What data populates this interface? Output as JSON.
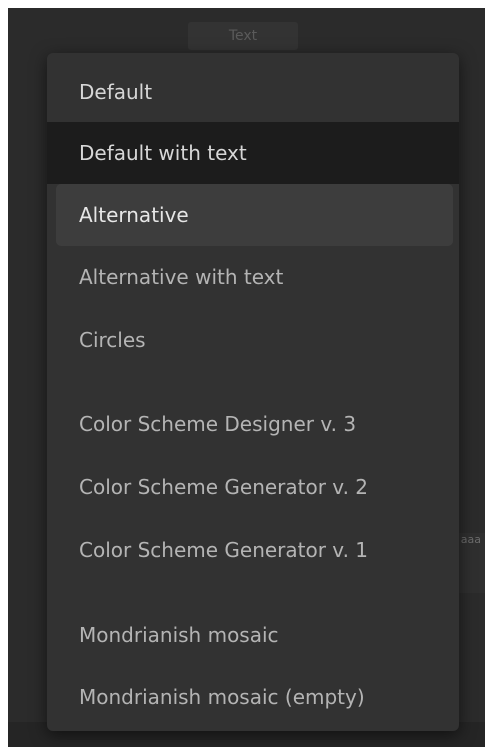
{
  "background": {
    "top_hint": "Text",
    "side_hint": "aa\naaa"
  },
  "menu": {
    "items": [
      {
        "label": "Default",
        "state": "normal"
      },
      {
        "label": "Default with text",
        "state": "selected"
      },
      {
        "label": "Alternative",
        "state": "hovered"
      },
      {
        "label": "Alternative with text",
        "state": "normal"
      },
      {
        "label": "Circles",
        "state": "normal"
      },
      {
        "label": "Color Scheme Designer v. 3",
        "state": "normal"
      },
      {
        "label": "Color Scheme Generator v. 2",
        "state": "normal"
      },
      {
        "label": "Color Scheme Generator v. 1",
        "state": "normal"
      },
      {
        "label": "Mondrianish mosaic",
        "state": "normal"
      },
      {
        "label": "Mondrianish mosaic (empty)",
        "state": "normal"
      }
    ]
  },
  "colors": {
    "menu_background": "#323232",
    "selected_background": "#1c1c1c",
    "hover_background": "#3d3d3d",
    "text": "#d7d7d7"
  }
}
